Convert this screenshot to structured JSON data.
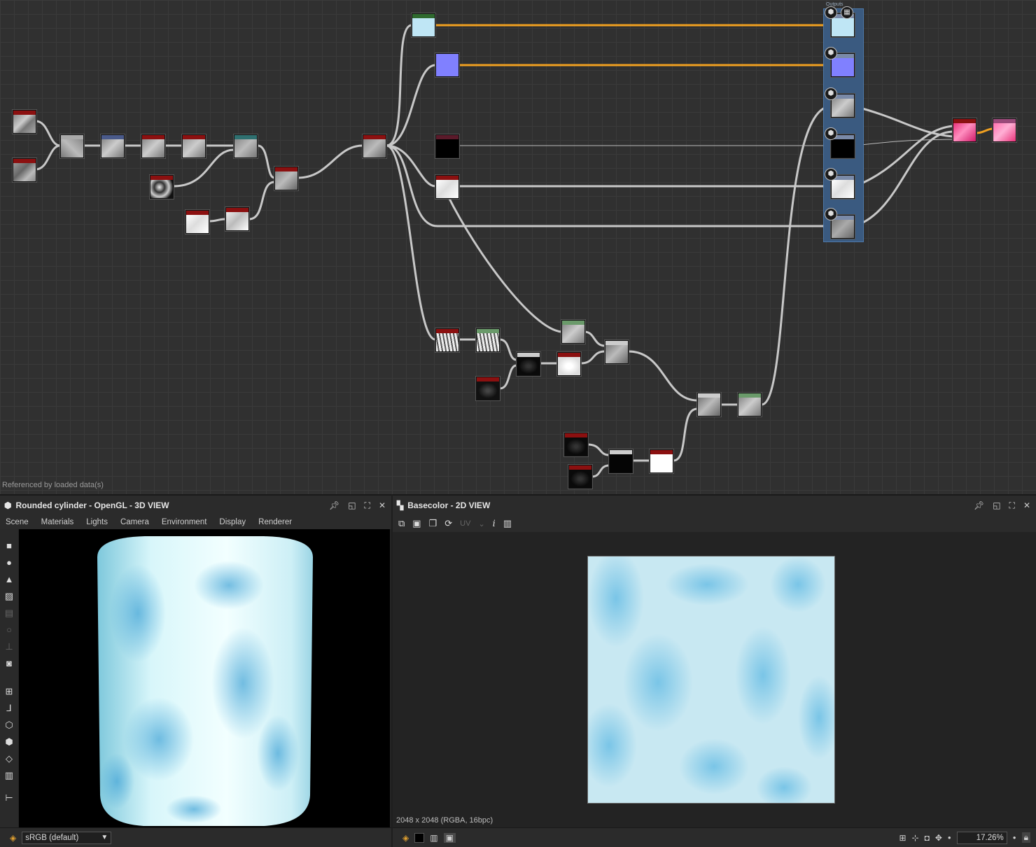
{
  "graph": {
    "status_text": "Referenced by loaded data(s)",
    "outputs_label": "Outputs"
  },
  "view3d": {
    "title": "Rounded cylinder - OpenGL - 3D VIEW",
    "menu": [
      "Scene",
      "Materials",
      "Lights",
      "Camera",
      "Environment",
      "Display",
      "Renderer"
    ],
    "colorspace": "sRGB (default)"
  },
  "view2d": {
    "title": "Basecolor - 2D VIEW",
    "uv_label": "UV",
    "info_label": "i",
    "image_info": "2048 x 2048 (RGBA, 16bpc)",
    "zoom": "17.26%"
  },
  "colors": {
    "graph_bg": "#303030",
    "wire": "#c8c8c8",
    "wire_active": "#f0a020",
    "outputs_frame": "#3a5a80",
    "node_bar_red": "#8b1010",
    "node_bar_green": "#4a7a4a",
    "node_bar_blue": "#4a5a8a",
    "node_bar_teal": "#2f7070"
  }
}
